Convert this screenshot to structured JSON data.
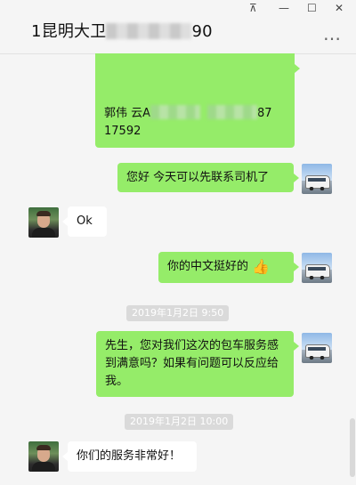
{
  "window": {
    "title_prefix": "1昆明大卫",
    "title_suffix": "90",
    "pin_icon": "pin-icon",
    "minimize_glyph": "—",
    "maximize_glyph": "☐",
    "close_glyph": "✕",
    "more_glyph": "…"
  },
  "messages": {
    "m1_line1_prefix": "郭伟  云A",
    "m1_line1_suffix": "87",
    "m1_line2": "17592",
    "m2": "您好  今天可以先联系司机了",
    "m3": "Ok",
    "m4": "你的中文挺好的",
    "m4_emoji": "👍",
    "t1": "2019年1月2日 9:50",
    "m5": "先生，您对我们这次的包车服务感到满意吗？如果有问题可以反应给我。",
    "t2": "2019年1月2日 10:00",
    "m6": "你们的服务非常好！"
  },
  "colors": {
    "sent_bubble": "#95ec69",
    "received_bubble": "#ffffff",
    "background": "#f5f5f5"
  }
}
